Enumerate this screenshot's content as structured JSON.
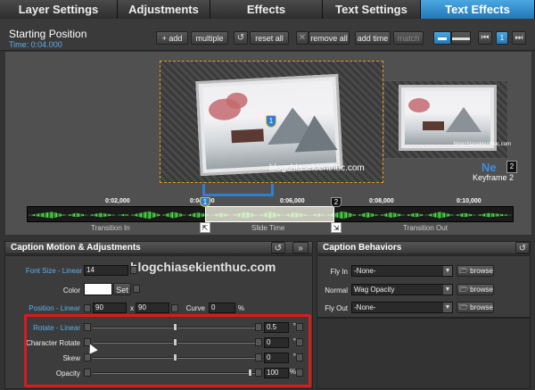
{
  "tabs": [
    {
      "label": "Layer Settings",
      "active": false
    },
    {
      "label": "Adjustments",
      "active": false
    },
    {
      "label": "Effects",
      "active": false
    },
    {
      "label": "Text Settings",
      "active": false
    },
    {
      "label": "Text Effects",
      "active": true
    }
  ],
  "header": {
    "title": "Starting Position",
    "time": "Time: 0:04.000",
    "add_label": "add",
    "multiple_label": "multiple",
    "reset_all_label": "reset all",
    "remove_all_label": "remove all",
    "add_time_label": "add time",
    "match_label": "match",
    "keyframe_badge": "1"
  },
  "preview": {
    "watermark_main": "blogchiasekienthuc.com",
    "watermark_small": "blogchiasekienthuc.com",
    "marker_current": "1",
    "next_label": "Ne",
    "next_keyframe": "Keyframe 2",
    "next_badge": "2"
  },
  "timeline": {
    "ticks": [
      "0:02,000",
      "0:04,000",
      "0:06,000",
      "0:08,000",
      "0:10,000"
    ],
    "marker1": "1",
    "marker2": "2",
    "transition_in": "Transition In",
    "slide_time": "Slide Time",
    "transition_out": "Transition Out"
  },
  "caption_motion": {
    "title": "Caption Motion & Adjustments",
    "watermark": "blogchiasekienthuc.com",
    "font_size_label": "Font Size - Linear",
    "font_size_value": "14",
    "color_label": "Color",
    "set_label": "Set",
    "position_label": "Position - Linear",
    "position_x": "90",
    "x_sep": "x",
    "position_y": "90",
    "curve_label": "Curve",
    "curve_value": "0",
    "curve_unit": "%",
    "rows": [
      {
        "label": "Rotate - Linear",
        "value": "0.5",
        "unit": "°",
        "position": 0.5
      },
      {
        "label": "Character Rotate",
        "value": "0",
        "unit": "°",
        "position": 0.0
      },
      {
        "label": "Skew",
        "value": "0",
        "unit": "°",
        "position": 0.5
      },
      {
        "label": "Opacity",
        "value": "100",
        "unit": "%",
        "position": 1.0
      }
    ]
  },
  "caption_behaviors": {
    "title": "Caption Behaviors",
    "rows": [
      {
        "label": "Fly In",
        "value": "-None-",
        "browse": "browse"
      },
      {
        "label": "Normal",
        "value": "Wag Opacity",
        "browse": "browse"
      },
      {
        "label": "Fly Out",
        "value": "-None-",
        "browse": "browse"
      }
    ]
  },
  "colors": {
    "accent": "#2e7fd0",
    "active_tab": "#2f8fd0",
    "highlight_box": "#d81c1c",
    "wave": "#5ccf52"
  }
}
